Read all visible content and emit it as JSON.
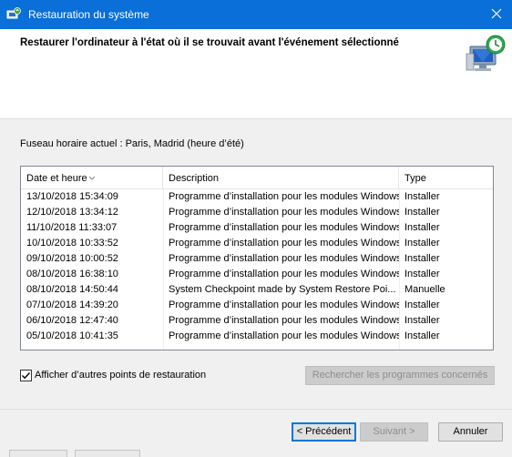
{
  "window": {
    "title": "Restauration du système",
    "app_icon": "system-restore-icon",
    "close_icon": "close-icon"
  },
  "header": {
    "heading": "Restaurer l'ordinateur à l'état où il se trouvait avant l'événement sélectionné",
    "icon": "restore-computer-icon"
  },
  "timezone_label": "Fuseau horaire actuel : Paris, Madrid (heure d’été)",
  "table": {
    "columns": [
      "Date et heure",
      "Description",
      "Type"
    ],
    "sort_icon": "sort-descending-icon",
    "rows": [
      {
        "date": "13/10/2018 15:34:09",
        "description": "Programme d’installation pour les modules Windows",
        "type": "Installer"
      },
      {
        "date": "12/10/2018 13:34:12",
        "description": "Programme d’installation pour les modules Windows",
        "type": "Installer"
      },
      {
        "date": "11/10/2018 11:33:07",
        "description": "Programme d’installation pour les modules Windows",
        "type": "Installer"
      },
      {
        "date": "10/10/2018 10:33:52",
        "description": "Programme d’installation pour les modules Windows",
        "type": "Installer"
      },
      {
        "date": "09/10/2018 10:00:52",
        "description": "Programme d’installation pour les modules Windows",
        "type": "Installer"
      },
      {
        "date": "08/10/2018 16:38:10",
        "description": "Programme d’installation pour les modules Windows",
        "type": "Installer"
      },
      {
        "date": "08/10/2018 14:50:44",
        "description": "System Checkpoint made by System Restore Poi...",
        "type": "Manuelle"
      },
      {
        "date": "07/10/2018 14:39:20",
        "description": "Programme d’installation pour les modules Windows",
        "type": "Installer"
      },
      {
        "date": "06/10/2018 12:47:40",
        "description": "Programme d’installation pour les modules Windows",
        "type": "Installer"
      },
      {
        "date": "05/10/2018 10:41:35",
        "description": "Programme d’installation pour les modules Windows",
        "type": "Installer"
      }
    ]
  },
  "show_more": {
    "label": "Afficher d’autres points de restauration",
    "checked": true
  },
  "buttons": {
    "scan": "Rechercher les programmes concernés",
    "back": "< Précédent",
    "next": "Suivant >",
    "cancel": "Annuler"
  },
  "colors": {
    "titlebar": "#0a6fd8",
    "default_button_border": "#0078d7"
  }
}
